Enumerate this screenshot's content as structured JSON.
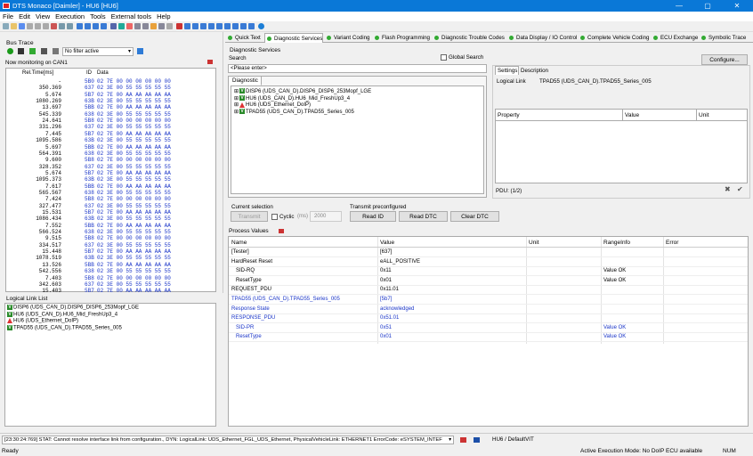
{
  "window": {
    "title": "DTS Monaco [Daimler] - HU6 [HU6]",
    "min": "—",
    "max": "▢",
    "close": "✕"
  },
  "menu": [
    "File",
    "Edit",
    "View",
    "Execution",
    "Tools",
    "External tools",
    "Help"
  ],
  "bus_trace": {
    "title": "Bus Trace",
    "filter": "No filter active",
    "monitoring": "Now monitoring on CAN1",
    "columns": [
      "Rel.Time[ms]",
      "ID",
      "Data"
    ],
    "rows": [
      [
        "-",
        "5B0",
        "02 7E 00 00 00 00 00 00"
      ],
      [
        "350.369",
        "637",
        "02 3E 00 55 55 55 55 55"
      ],
      [
        "5.674",
        "5B7",
        "02 7E 00 AA AA AA AA AA"
      ],
      [
        "1080.269",
        "63B",
        "02 3E 00 55 55 55 55 55"
      ],
      [
        "13.697",
        "5BB",
        "02 7E 00 AA AA AA AA AA"
      ],
      [
        "545.339",
        "638",
        "02 3E 00 55 55 55 55 55"
      ],
      [
        "24.641",
        "5B8",
        "02 7E 00 00 00 00 00 00"
      ],
      [
        "331.296",
        "637",
        "02 3E 00 55 55 55 55 55"
      ],
      [
        "7.445",
        "5B7",
        "02 7E 00 AA AA AA AA AA"
      ],
      [
        "1095.586",
        "63B",
        "02 3E 00 55 55 55 55 55"
      ],
      [
        "5.697",
        "5BB",
        "02 7E 00 AA AA AA AA AA"
      ],
      [
        "564.391",
        "638",
        "02 3E 00 55 55 55 55 55"
      ],
      [
        "9.600",
        "5B8",
        "02 7E 00 00 00 00 00 00"
      ],
      [
        "328.352",
        "637",
        "02 3E 00 55 55 55 55 55"
      ],
      [
        "5.674",
        "5B7",
        "02 7E 00 AA AA AA AA AA"
      ],
      [
        "1095.373",
        "63B",
        "02 3E 00 55 55 55 55 55"
      ],
      [
        "7.617",
        "5BB",
        "02 7E 00 AA AA AA AA AA"
      ],
      [
        "565.567",
        "638",
        "02 3E 00 55 55 55 55 55"
      ],
      [
        "7.424",
        "5B8",
        "02 7E 00 00 00 00 00 00"
      ],
      [
        "327.477",
        "637",
        "02 3E 00 55 55 55 55 55"
      ],
      [
        "15.531",
        "5B7",
        "02 7E 00 AA AA AA AA AA"
      ],
      [
        "1086.434",
        "63B",
        "02 3E 00 55 55 55 55 55"
      ],
      [
        "7.552",
        "5BB",
        "02 7E 00 AA AA AA AA AA"
      ],
      [
        "566.524",
        "638",
        "02 3E 00 55 55 55 55 55"
      ],
      [
        "9.515",
        "5B8",
        "02 7E 00 00 00 00 00 00"
      ],
      [
        "334.517",
        "637",
        "02 3E 00 55 55 55 55 55"
      ],
      [
        "15.448",
        "5B7",
        "02 7E 00 AA AA AA AA AA"
      ],
      [
        "1078.519",
        "63B",
        "02 3E 00 55 55 55 55 55"
      ],
      [
        "13.526",
        "5BB",
        "02 7E 00 AA AA AA AA AA"
      ],
      [
        "542.556",
        "638",
        "02 3E 00 55 55 55 55 55"
      ],
      [
        "7.403",
        "5B8",
        "02 7E 00 00 00 00 00 00"
      ],
      [
        "342.603",
        "637",
        "02 3E 00 55 55 55 55 55"
      ],
      [
        "15.403",
        "5B7",
        "02 7E 00 AA AA AA AA AA"
      ]
    ]
  },
  "logical_link_list": {
    "title": "Logical Link List",
    "items": [
      {
        "type": "ok",
        "label": "DISP6 (UDS_CAN_D).DISP6_DISP6_253Mopf_LGE"
      },
      {
        "type": "ok",
        "label": "HU6 (UDS_CAN_D).HU6_Mid_FreshUp3_4"
      },
      {
        "type": "warn",
        "label": "HU6 (UDS_Ethernet_DoIP)"
      },
      {
        "type": "ok",
        "label": "TPAD55 (UDS_CAN_D).TPAD55_Series_005"
      }
    ]
  },
  "tabs": [
    "Quick Text",
    "Diagnostic Services",
    "Variant Coding",
    "Flash Programming",
    "Diagnostic Trouble Codes",
    "Data Display / IO Control",
    "Complete Vehicle Coding",
    "ECU Exchange",
    "Symbolic Trace"
  ],
  "diag": {
    "title": "Diagnostic Services",
    "search_label": "Search",
    "search_placeholder": "<Please enter>",
    "global_search": "Global Search",
    "configure": "Configure...",
    "tree_tab": "Diagnostic",
    "tree": [
      {
        "type": "ok",
        "label": "DISP6 (UDS_CAN_D).DISP6_DISP6_253Mopf_LGE"
      },
      {
        "type": "ok",
        "label": "HU6 (UDS_CAN_D).HU6_Mid_FreshUp3_4"
      },
      {
        "type": "warn",
        "label": "HU6 (UDS_Ethernet_DoIP)"
      },
      {
        "type": "ok",
        "label": "TPAD55 (UDS_CAN_D).TPAD55_Series_005"
      }
    ],
    "settings_tabs": [
      "Settings",
      "Description"
    ],
    "logical_link_label": "Logical Link",
    "logical_link_value": "TPAD55 (UDS_CAN_D).TPAD55_Series_005",
    "prop_cols": [
      "Property",
      "Value",
      "Unit"
    ],
    "pdu": "PDU: (1/2)"
  },
  "current_selection": {
    "title": "Current selection",
    "transmit": "Transmit",
    "cyclic": "Cyclic",
    "ms": "(ms)",
    "interval": "2000"
  },
  "transmit_preconf": {
    "title": "Transmit preconfigured",
    "buttons": [
      "Read ID",
      "Read DTC",
      "Clear DTC"
    ]
  },
  "process_values": {
    "title": "Process Values",
    "columns": [
      "Name",
      "Value",
      "Unit",
      "RangeInfo",
      "Error"
    ],
    "rows": [
      {
        "name": "[Tester]",
        "value": "[637]",
        "unit": "",
        "range": "",
        "error": "",
        "blue": false,
        "indent": false
      },
      {
        "name": "HardReset Reset",
        "value": "eALL_POSITIVE",
        "unit": "",
        "range": "",
        "error": "",
        "blue": false,
        "indent": false
      },
      {
        "name": "SID-RQ",
        "value": "0x11",
        "unit": "",
        "range": "Value OK",
        "error": "",
        "blue": false,
        "indent": true
      },
      {
        "name": "ResetType",
        "value": "0x01",
        "unit": "",
        "range": "Value OK",
        "error": "",
        "blue": false,
        "indent": true
      },
      {
        "name": "REQUEST_PDU",
        "value": "0x11.01",
        "unit": "",
        "range": "",
        "error": "",
        "blue": false,
        "indent": false
      },
      {
        "name": "TPAD55 (UDS_CAN_D).TPAD55_Series_005",
        "value": "[5b7]",
        "unit": "",
        "range": "",
        "error": "",
        "blue": true,
        "indent": false
      },
      {
        "name": "Response State",
        "value": "acknowledged",
        "unit": "",
        "range": "",
        "error": "",
        "blue": true,
        "indent": false
      },
      {
        "name": "RESPONSE_PDU",
        "value": "0x51.01",
        "unit": "",
        "range": "",
        "error": "",
        "blue": true,
        "indent": false
      },
      {
        "name": "SID-PR",
        "value": "0x51",
        "unit": "",
        "range": "Value OK",
        "error": "",
        "blue": true,
        "indent": true
      },
      {
        "name": "ResetType",
        "value": "0x01",
        "unit": "",
        "range": "Value OK",
        "error": "",
        "blue": true,
        "indent": true
      }
    ]
  },
  "status": {
    "message": "[23:30:24:769] STAT: Cannot resolve interface link from configuration., DYN: LogicalLink: UDS_Ethernet_FGL_UDS_Ethernet, PhysicalVehicleLink: ETHERNET1 ErrorCode: eSYSTEM_INTEF",
    "workspace": "HU6 / DefaultVIT",
    "ready": "Ready",
    "mode": "Active Execution Mode: No DoIP ECU available",
    "num": "NUM"
  },
  "colors": {
    "titlebar": "#0a78d7",
    "ok_badge": "#2a8a2a",
    "warn": "#dd3333",
    "blue_text": "#1a35c8",
    "hex_text": "#1a35c8"
  }
}
